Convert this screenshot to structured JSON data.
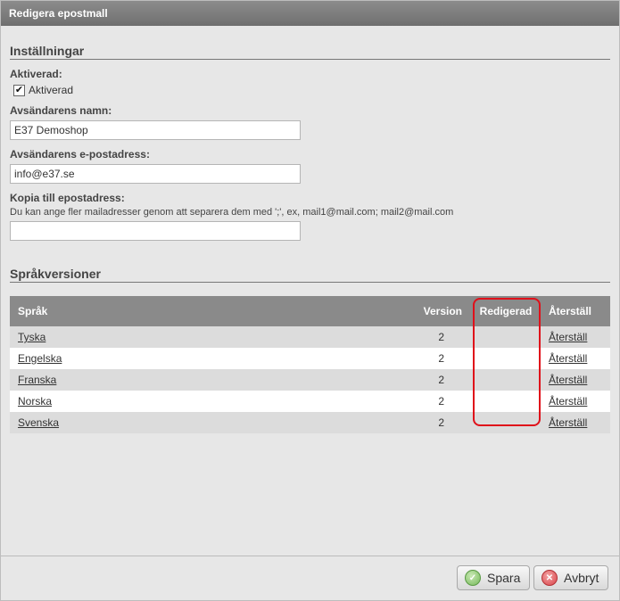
{
  "dialog": {
    "title": "Redigera epostmall"
  },
  "settings": {
    "section_title": "Inställningar",
    "activated_label": "Aktiverad:",
    "activated_checkbox_label": "Aktiverad",
    "activated_checked": true,
    "sender_name_label": "Avsändarens namn:",
    "sender_name_value": "E37 Demoshop",
    "sender_email_label": "Avsändarens e-postadress:",
    "sender_email_value": "info@e37.se",
    "cc_label": "Kopia till epostadress:",
    "cc_hint": "Du kan ange fler mailadresser genom att separera dem med ';', ex, mail1@mail.com; mail2@mail.com",
    "cc_value": ""
  },
  "languages": {
    "section_title": "Språkversioner",
    "columns": {
      "language": "Språk",
      "version": "Version",
      "edited": "Redigerad",
      "reset": "Återställ"
    },
    "rows": [
      {
        "language": "Tyska",
        "version": "2",
        "edited": "",
        "reset": "Återställ"
      },
      {
        "language": "Engelska",
        "version": "2",
        "edited": "",
        "reset": "Återställ"
      },
      {
        "language": "Franska",
        "version": "2",
        "edited": "",
        "reset": "Återställ"
      },
      {
        "language": "Norska",
        "version": "2",
        "edited": "",
        "reset": "Återställ"
      },
      {
        "language": "Svenska",
        "version": "2",
        "edited": "",
        "reset": "Återställ"
      }
    ]
  },
  "footer": {
    "save_label": "Spara",
    "cancel_label": "Avbryt"
  },
  "colors": {
    "highlight": "#e0101a",
    "header_bg": "#8a8a8a",
    "titlebar": "#7a7a7a"
  }
}
